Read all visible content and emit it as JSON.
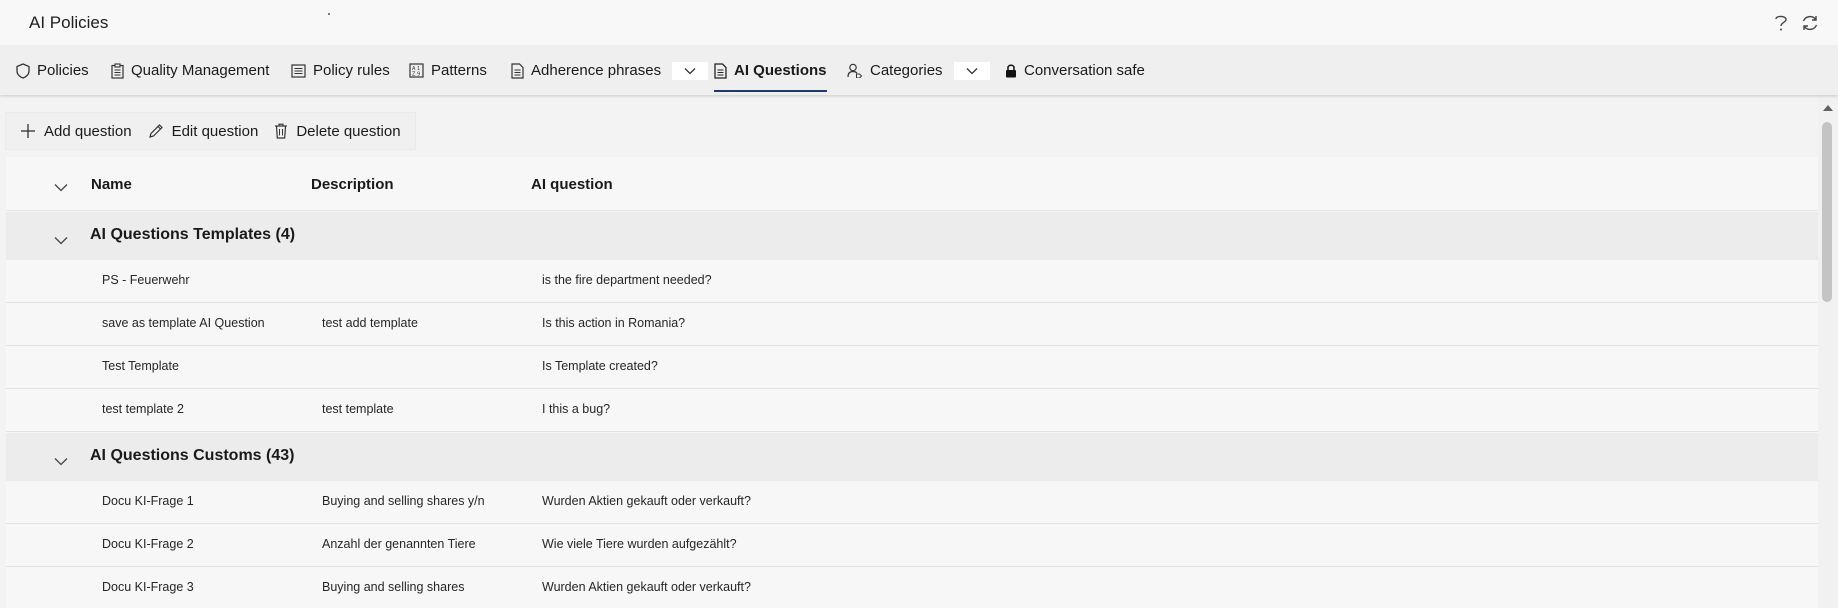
{
  "app": {
    "title": "AI Policies"
  },
  "top_icons": [
    "help-icon",
    "refresh-icon"
  ],
  "nav": {
    "tabs": [
      {
        "label": "Policies",
        "icon": "shield-icon"
      },
      {
        "label": "Quality Management",
        "icon": "clipboard-icon"
      },
      {
        "label": "Policy rules",
        "icon": "list-icon"
      },
      {
        "label": "Patterns",
        "icon": "pattern-icon"
      },
      {
        "label": "Adherence phrases",
        "icon": "document-icon",
        "dropdown": true
      },
      {
        "label": "AI Questions",
        "icon": "document-icon",
        "active": true
      },
      {
        "label": "Categories",
        "icon": "person-tag-icon",
        "dropdown": true
      },
      {
        "label": "Conversation safe",
        "icon": "lock-icon"
      }
    ],
    "active_color": "#1f3a6e"
  },
  "toolbar": {
    "add_label": "Add question",
    "edit_label": "Edit question",
    "delete_label": "Delete question"
  },
  "grid": {
    "columns": {
      "name": "Name",
      "description": "Description",
      "question": "AI question"
    },
    "groups": [
      {
        "title": "AI Questions Templates (4)",
        "rows": [
          {
            "name": "PS - Feuerwehr",
            "description": "",
            "question": "is the fire department needed?"
          },
          {
            "name": "save as template AI Question",
            "description": "test add template",
            "question": "Is this action in Romania?"
          },
          {
            "name": "Test Template",
            "description": "",
            "question": "Is Template created?"
          },
          {
            "name": "test template 2",
            "description": "test template",
            "question": "I this a bug?"
          }
        ]
      },
      {
        "title": "AI Questions Customs (43)",
        "rows": [
          {
            "name": "Docu KI-Frage 1",
            "description": "Buying and selling shares y/n",
            "question": "Wurden Aktien gekauft oder verkauft?"
          },
          {
            "name": "Docu KI-Frage 2",
            "description": "Anzahl der genannten Tiere",
            "question": "Wie viele Tiere wurden aufgezählt?"
          },
          {
            "name": "Docu KI-Frage 3",
            "description": "Buying and selling shares",
            "question": "Wurden Aktien gekauft oder verkauft?"
          }
        ]
      }
    ]
  }
}
